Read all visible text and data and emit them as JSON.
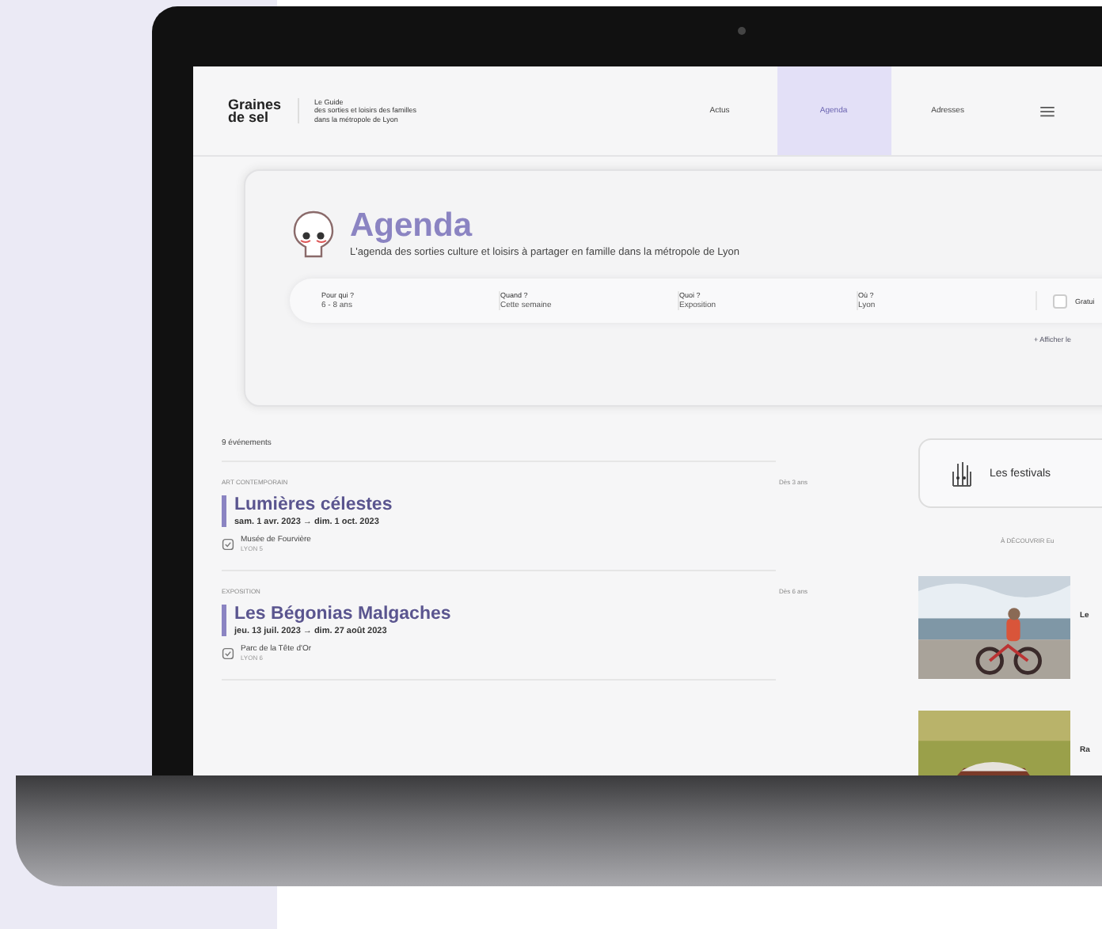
{
  "header": {
    "logo": [
      "Graines",
      "de sel"
    ],
    "tagline": [
      "Le Guide",
      "des sorties et loisirs des familles",
      "dans la métropole de Lyon"
    ],
    "nav": [
      {
        "label": "Actus",
        "selected": false
      },
      {
        "label": "Agenda",
        "selected": true
      },
      {
        "label": "Adresses",
        "selected": false
      }
    ]
  },
  "hero": {
    "title": "Agenda",
    "subtitle": "L'agenda des sorties culture et loisirs à partager en famille dans la métropole de Lyon",
    "filters": [
      {
        "label": "Pour qui ?",
        "value": "6 - 8 ans"
      },
      {
        "label": "Quand ?",
        "value": "Cette semaine"
      },
      {
        "label": "Quoi ?",
        "value": "Exposition"
      },
      {
        "label": "Où ?",
        "value": "Lyon"
      }
    ],
    "free": {
      "label": "Gratui",
      "checked": false
    },
    "more_link": "+ Afficher le"
  },
  "events_count": "9 événements",
  "events": [
    {
      "category": "ART CONTEMPORAIN",
      "age": "Dès 3 ans",
      "title": "Lumières célestes",
      "dates": "sam. 1 avr. 2023  →  dim. 1 oct. 2023",
      "place": "Musée de Fourvière",
      "city": "LYON 5"
    },
    {
      "category": "EXPOSITION",
      "age": "Dès 6 ans",
      "title": "Les Bégonias Malgaches",
      "dates": "jeu. 13 juil. 2023  →  dim. 27 août 2023",
      "place": "Parc de la Tête d'Or",
      "city": "LYON 6"
    }
  ],
  "sidebar": {
    "festivals": "Les festivals",
    "discover": "À DÉCOUVRIR Eu",
    "cards": [
      {
        "kind": "bike",
        "title": "Le"
      },
      {
        "kind": "hut",
        "title": "Ra"
      }
    ]
  }
}
